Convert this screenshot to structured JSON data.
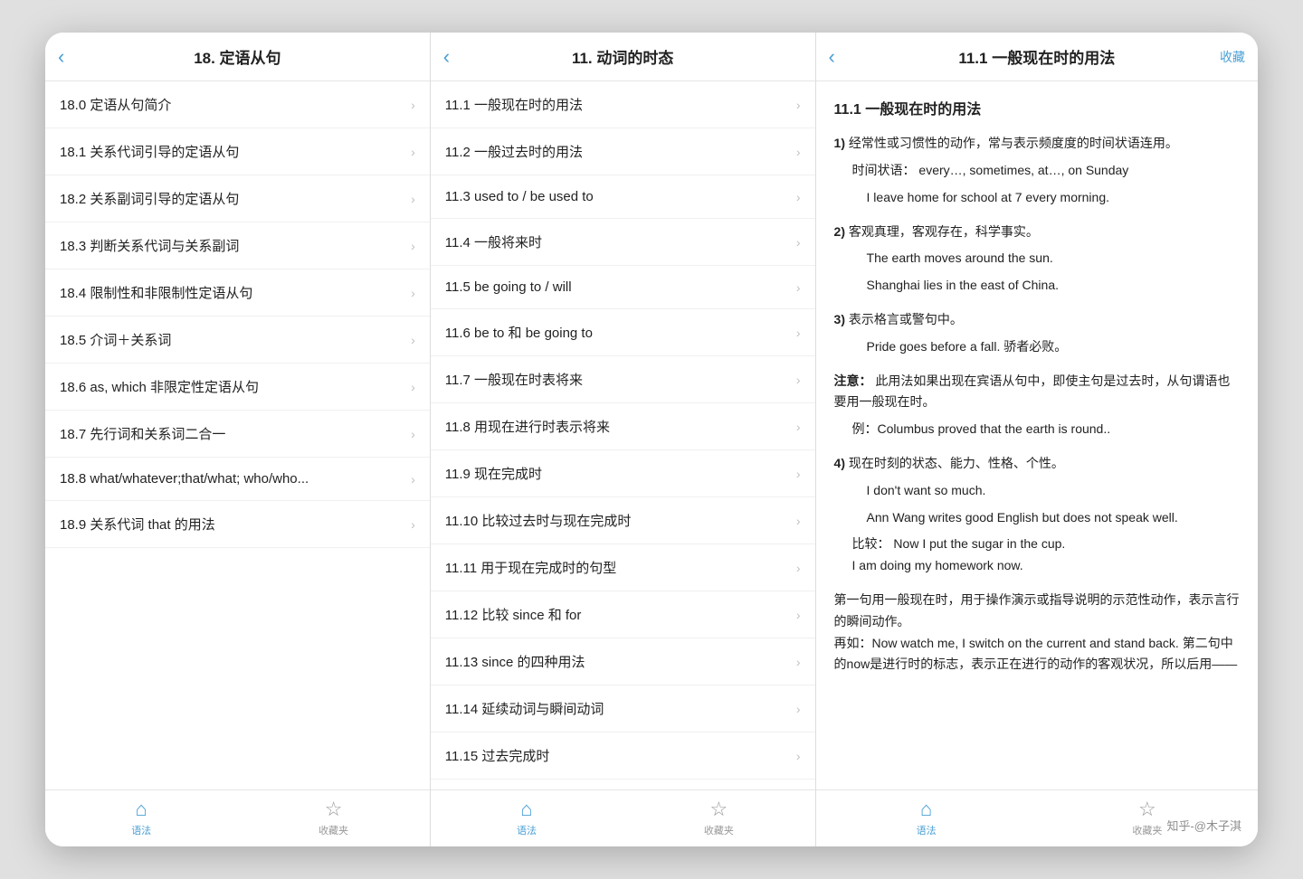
{
  "panel1": {
    "header": {
      "back": "‹",
      "title": "18. 定语从句"
    },
    "items": [
      {
        "id": "18.0",
        "label": "18.0 定语从句简介"
      },
      {
        "id": "18.1",
        "label": "18.1 关系代词引导的定语从句"
      },
      {
        "id": "18.2",
        "label": "18.2 关系副词引导的定语从句"
      },
      {
        "id": "18.3",
        "label": "18.3 判断关系代词与关系副词"
      },
      {
        "id": "18.4",
        "label": "18.4 限制性和非限制性定语从句"
      },
      {
        "id": "18.5",
        "label": "18.5 介词＋关系词"
      },
      {
        "id": "18.6",
        "label": "18.6 as, which 非限定性定语从句"
      },
      {
        "id": "18.7",
        "label": "18.7 先行词和关系词二合一"
      },
      {
        "id": "18.8",
        "label": "18.8 what/whatever;that/what; who/who..."
      },
      {
        "id": "18.9",
        "label": "18.9 关系代词 that 的用法"
      }
    ],
    "tabBar": {
      "items": [
        {
          "icon": "⌂",
          "label": "语法",
          "active": true
        },
        {
          "icon": "☆",
          "label": "收藏夹",
          "active": false
        }
      ]
    }
  },
  "panel2": {
    "header": {
      "back": "‹",
      "title": "11. 动词的时态"
    },
    "items": [
      {
        "id": "11.1",
        "label": "11.1 一般现在时的用法"
      },
      {
        "id": "11.2",
        "label": "11.2 一般过去时的用法"
      },
      {
        "id": "11.3",
        "label": "11.3 used to / be used to"
      },
      {
        "id": "11.4",
        "label": "11.4 一般将来时"
      },
      {
        "id": "11.5",
        "label": "11.5 be going to / will"
      },
      {
        "id": "11.6",
        "label": "11.6 be to 和 be going to"
      },
      {
        "id": "11.7",
        "label": "11.7 一般现在时表将来"
      },
      {
        "id": "11.8",
        "label": "11.8 用现在进行时表示将来"
      },
      {
        "id": "11.9",
        "label": "11.9 现在完成时"
      },
      {
        "id": "11.10",
        "label": "11.10 比较过去时与现在完成时"
      },
      {
        "id": "11.11",
        "label": "11.11 用于现在完成时的句型"
      },
      {
        "id": "11.12",
        "label": "11.12 比较 since 和 for"
      },
      {
        "id": "11.13",
        "label": "11.13 since 的四种用法"
      },
      {
        "id": "11.14",
        "label": "11.14 延续动词与瞬间动词"
      },
      {
        "id": "11.15",
        "label": "11.15 过去完成时"
      }
    ],
    "tabBar": {
      "items": [
        {
          "icon": "⌂",
          "label": "语法",
          "active": true
        },
        {
          "icon": "☆",
          "label": "收藏夹",
          "active": false
        }
      ]
    }
  },
  "panel3": {
    "header": {
      "back": "‹",
      "title": "11.1 一般现在时的用法",
      "collect": "收藏"
    },
    "content": {
      "heading": "11.1 一般现在时的用法",
      "sections": [
        {
          "num": "1)",
          "main": "经常性或习惯性的动作，常与表示频度度的时间状语连用。",
          "sub": "时间状语：  every…, sometimes,   at…, on Sunday",
          "examples": [
            "I leave home for school at 7 every morning."
          ]
        },
        {
          "num": "2)",
          "main": "客观真理，客观存在，科学事实。",
          "examples": [
            "The earth moves around the sun.",
            "Shanghai lies in the east of China."
          ]
        },
        {
          "num": "3)",
          "main": "表示格言或警句中。",
          "examples": [
            "Pride goes before a fall.   骄者必败。"
          ]
        },
        {
          "num": "注意：",
          "main": "此用法如果出现在宾语从句中，即使主句是过去时，从句谓语也要用一般现在时。",
          "sub": "例：Columbus proved that the earth is round.."
        },
        {
          "num": "4)",
          "main": "现在时刻的状态、能力、性格、个性。",
          "examples": [
            "I don't want so much.",
            "Ann Wang writes good English but does not speak well."
          ],
          "compare": "比较：  Now I put the sugar in the cup.\n        I am doing my homework now."
        },
        {
          "num": "",
          "main": "第一句用一般现在时，用于操作演示或指导说明的示范性动作，表示言行的瞬间动作。\n再如：Now watch me, I switch on the current and stand back. 第二句中的now是进行时的标志，表示正在进行的动作的客观状况，所以后用——"
        }
      ]
    },
    "tabBar": {
      "items": [
        {
          "icon": "⌂",
          "label": "语法",
          "active": true
        },
        {
          "icon": "☆",
          "label": "收藏夹",
          "active": false
        }
      ]
    }
  },
  "watermark": "知乎-@木子淇"
}
